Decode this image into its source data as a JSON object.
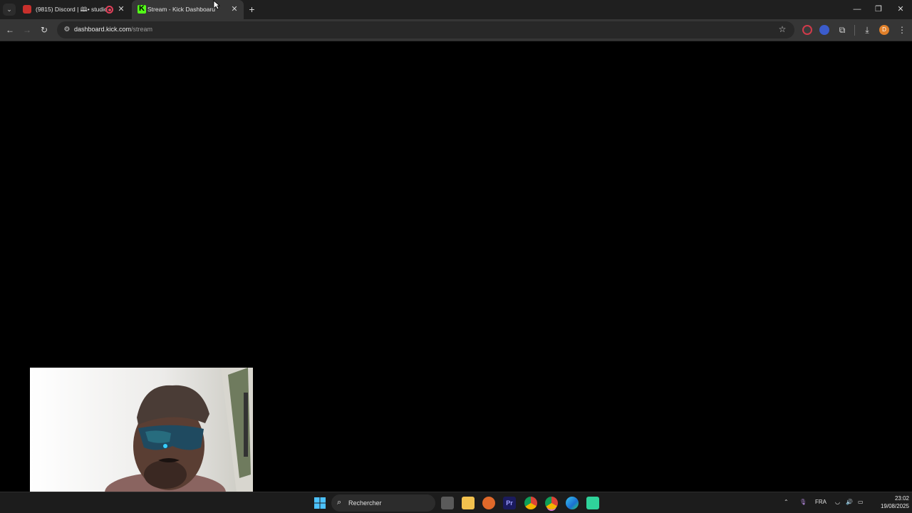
{
  "browser": {
    "tabs": [
      {
        "title": "(9815) Discord | 🕮• studio",
        "active": false,
        "recording": true
      },
      {
        "title": "Stream - Kick Dashboard",
        "active": true
      }
    ],
    "url_host": "dashboard.kick.com",
    "url_path": "/stream",
    "profile_initial": "D",
    "window_controls": {
      "minimize": "—",
      "restore": "❐",
      "close": "✕"
    }
  },
  "taskbar": {
    "search_placeholder": "Rechercher",
    "language": "FRA",
    "time": "23:02",
    "date": "19/08/2025"
  },
  "colors": {
    "kick_green": "#53fc18",
    "chrome_toolbar": "#363636",
    "tab_strip": "#1f1f1f",
    "taskbar": "#1c1c1c"
  },
  "icons": {
    "tab_list": "chevron-down-icon",
    "new_tab": "plus-icon",
    "back": "arrow-left-icon",
    "forward": "arrow-right-icon",
    "reload": "reload-icon",
    "site_info": "tune-icon",
    "bookmark": "star-icon",
    "extensions": "puzzle-icon",
    "downloads": "download-icon",
    "menu": "kebab-icon"
  }
}
